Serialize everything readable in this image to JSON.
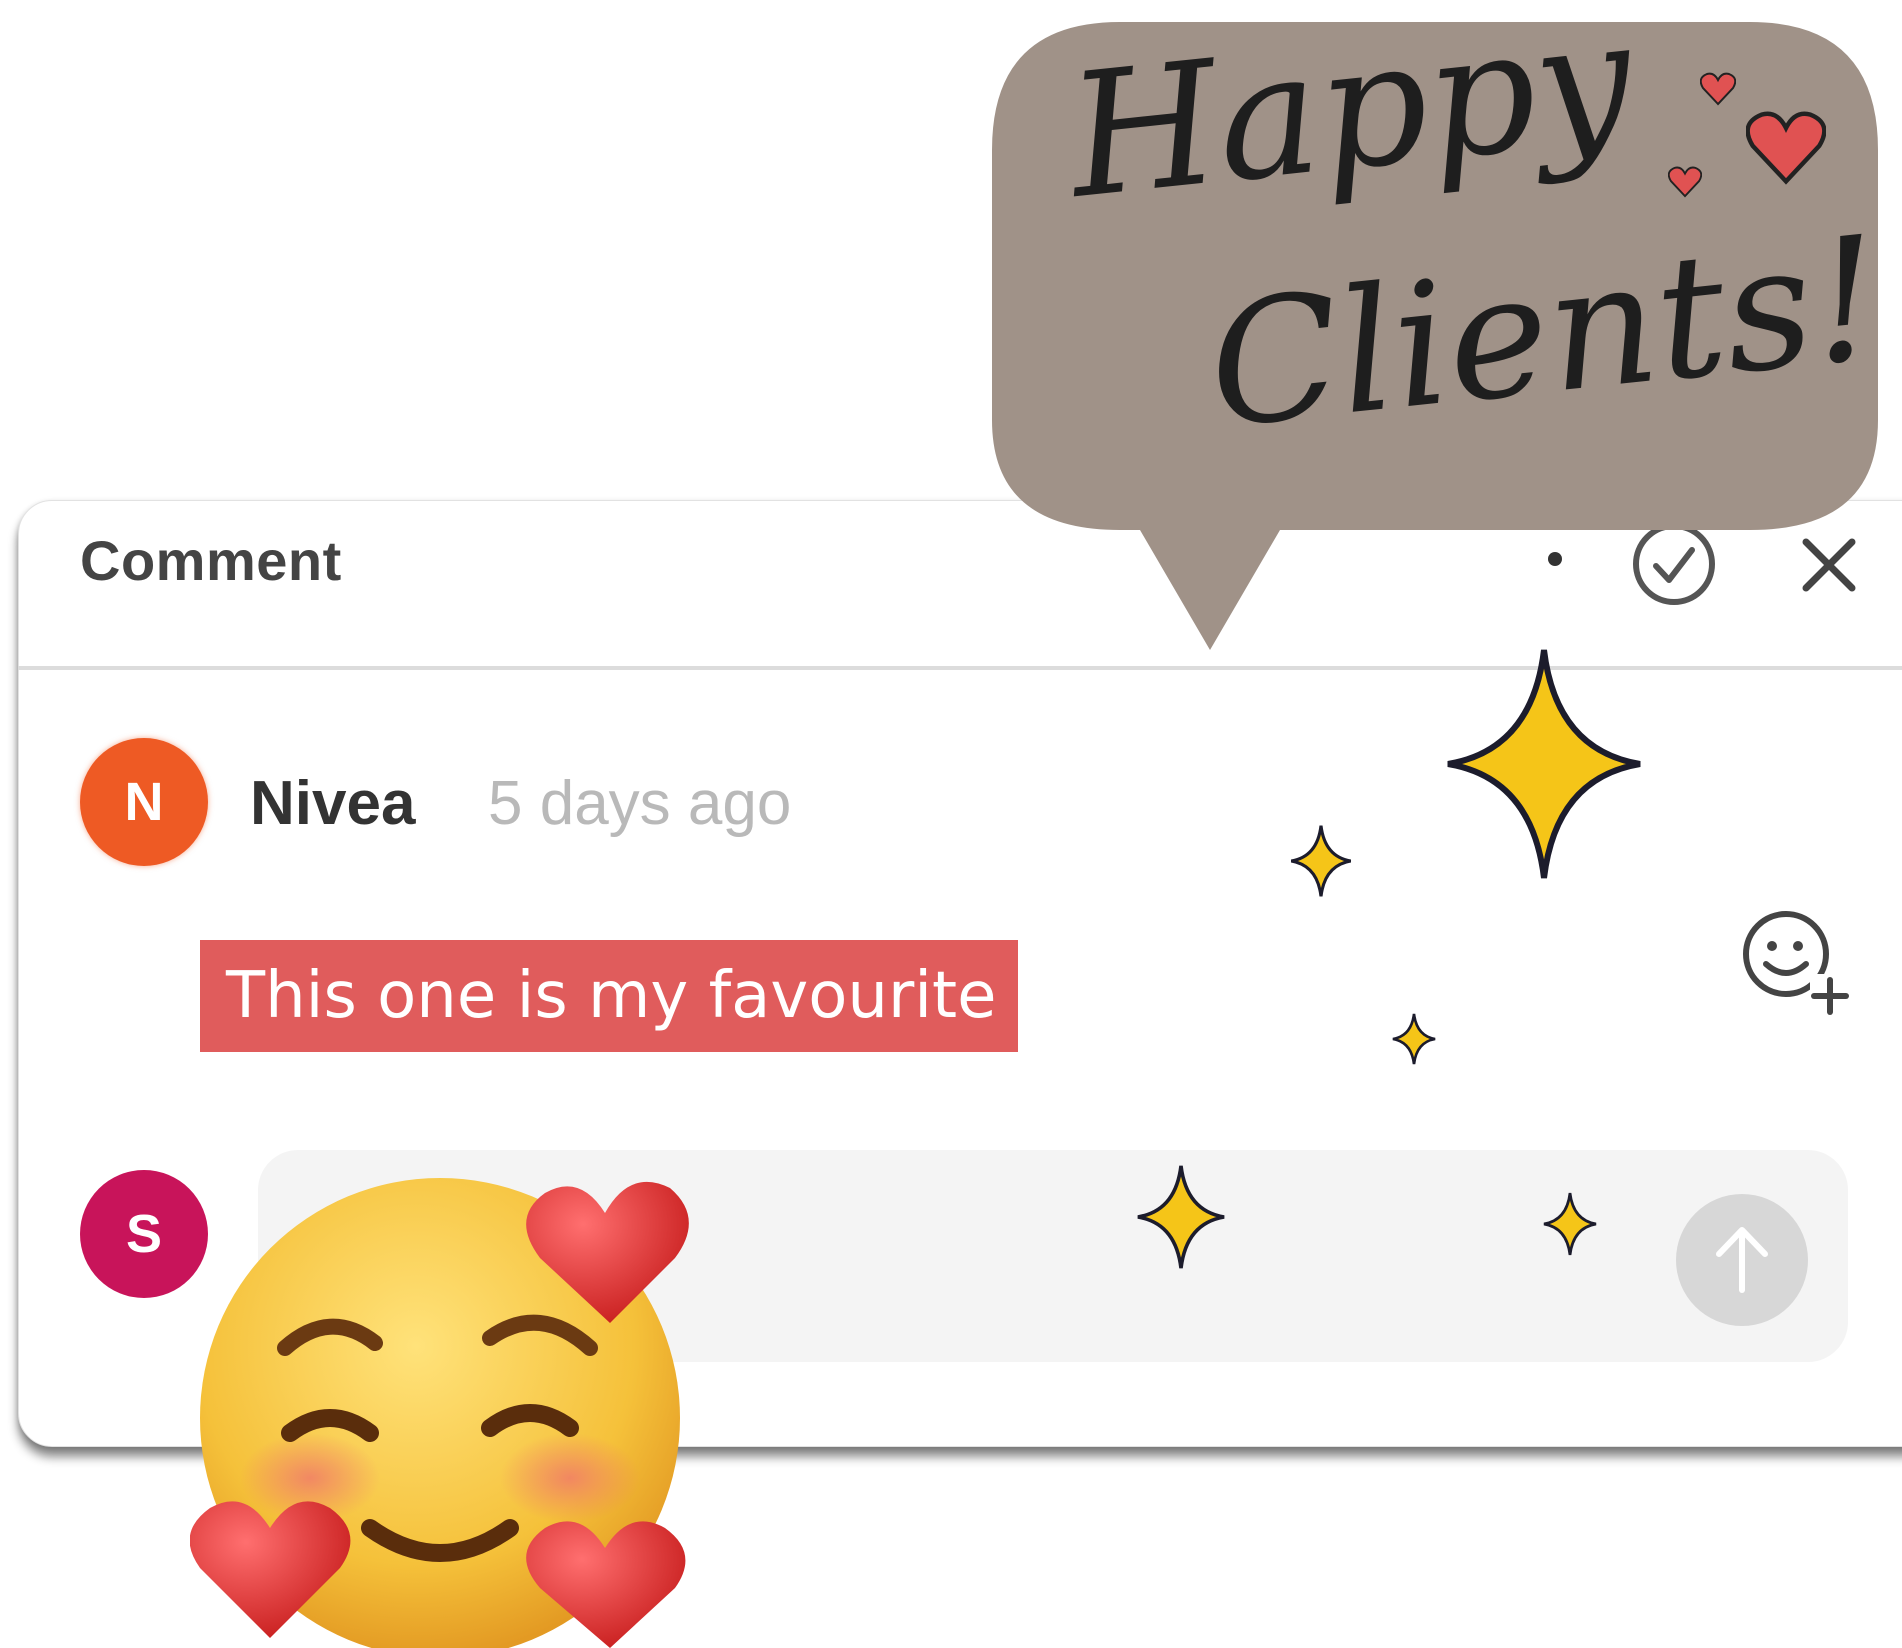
{
  "panel": {
    "title": "Comment"
  },
  "comment": {
    "author_initial": "N",
    "author": "Nivea",
    "time": "5 days ago",
    "text": "This one is my favourite"
  },
  "reply": {
    "user_initial": "S",
    "placeholder": ""
  },
  "bubble": {
    "line1": "Happy",
    "line2": "Clients!"
  },
  "colors": {
    "bubble_bg": "#a09288",
    "comment_highlight": "#e05c5c",
    "avatar_n": "#ee5a24",
    "avatar_s": "#c8145a",
    "sparkle": "#f5c518"
  },
  "icons": [
    "more-icon",
    "check-circle-icon",
    "close-icon",
    "add-reaction-icon",
    "send-arrow-icon",
    "sparkle-icon",
    "heart-icon",
    "smiling-face-with-hearts-emoji"
  ]
}
